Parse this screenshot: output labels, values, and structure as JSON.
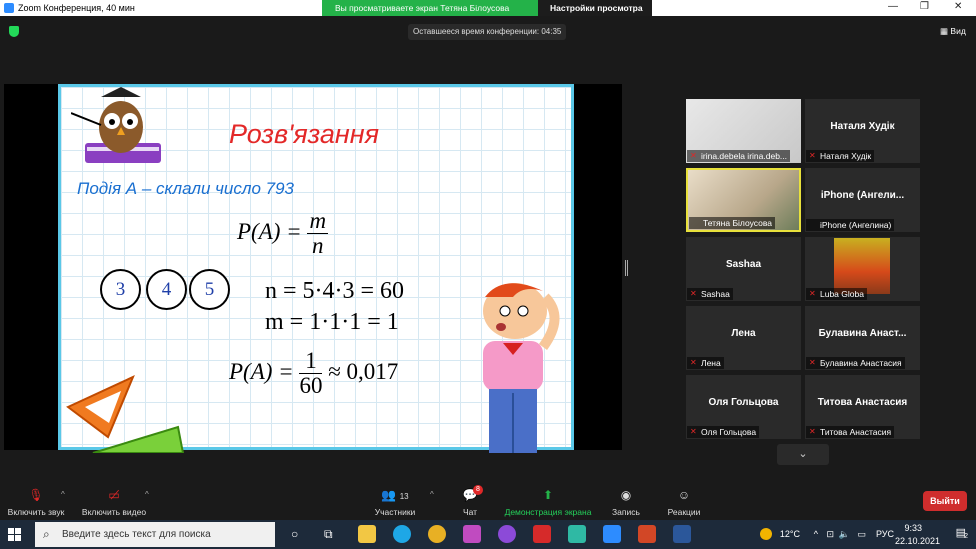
{
  "window": {
    "title": "Zoom Конференция, 40 мин"
  },
  "share_banner": {
    "message": "Вы просматриваете экран Тетяна Білоусова",
    "options_label": "Настройки просмотра"
  },
  "meeting": {
    "timer_text": "Оставшееся время конференции: 04:35",
    "view_label": "Вид"
  },
  "slide": {
    "title": "Розв'язання",
    "event_text": "Подія А – склали число 793",
    "f1_left": "P(A) =",
    "f1_num": "m",
    "f1_den": "n",
    "f2": "n = 5·4·3 = 60",
    "f3": "m = 1·1·1 = 1",
    "f4_left": "P(A) =",
    "f4_num": "1",
    "f4_den": "60",
    "f4_right": "≈ 0,017",
    "digits": [
      "3",
      "4",
      "5"
    ]
  },
  "participants": [
    {
      "name_big": "",
      "label": "irina.debela irina.deb...",
      "muted": true,
      "video": true
    },
    {
      "name_big": "Наталя Худік",
      "label": "Наталя Худік",
      "muted": true,
      "video": false
    },
    {
      "name_big": "",
      "label": "Тетяна Білоусова",
      "muted": false,
      "video": true,
      "active": true
    },
    {
      "name_big": "iPhone (Ангели...",
      "label": "iPhone (Ангелина)",
      "muted": false,
      "video": false
    },
    {
      "name_big": "Sashaa",
      "label": "Sashaa",
      "muted": true,
      "video": false
    },
    {
      "name_big": "",
      "label": "Luba Globa",
      "muted": true,
      "video": false,
      "avatar": true
    },
    {
      "name_big": "Лена",
      "label": "Лена",
      "muted": true,
      "video": false
    },
    {
      "name_big": "Булавина Анаст...",
      "label": "Булавина Анастасия",
      "muted": true,
      "video": false
    },
    {
      "name_big": "Оля Гольцова",
      "label": "Оля Гольцова",
      "muted": true,
      "video": false
    },
    {
      "name_big": "Титова Анастасия",
      "label": "Титова Анастасия",
      "muted": true,
      "video": false
    }
  ],
  "toolbar": {
    "audio_label": "Включить звук",
    "video_label": "Включить видео",
    "participants_label": "Участники",
    "participants_count": "13",
    "chat_label": "Чат",
    "chat_badge": "8",
    "share_label": "Демонстрация экрана",
    "record_label": "Запись",
    "reactions_label": "Реакции",
    "leave_label": "Выйти"
  },
  "taskbar": {
    "search_placeholder": "Введите здесь текст для поиска",
    "weather": "12°C",
    "language": "РУС",
    "time": "9:33",
    "date": "22.10.2021",
    "notification_count": "2"
  },
  "colors": {
    "share_green": "#24b249",
    "leave_red": "#cf2d2d",
    "slide_title": "#e32828",
    "slide_event": "#1a6fd0"
  }
}
